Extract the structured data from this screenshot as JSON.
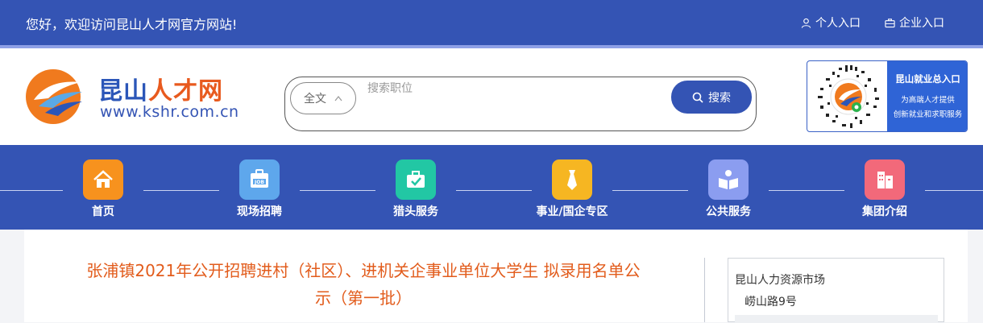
{
  "topbar": {
    "welcome": "您好，欢迎访问昆山人才网官方网站!",
    "personal_entry": "个人入口",
    "company_entry": "企业入口"
  },
  "logo": {
    "cn_part1": "昆山",
    "cn_part2": "人才网",
    "en": "www.kshr.com.cn"
  },
  "search": {
    "scope": "全文",
    "placeholder": "搜索职位",
    "button": "搜索"
  },
  "promo": {
    "title": "昆山就业总入口",
    "line1": "为高端人才提供",
    "line2": "创新就业和求职服务"
  },
  "nav": {
    "items": [
      {
        "label": "首页",
        "icon": "home-icon",
        "color": "#f7921e"
      },
      {
        "label": "现场招聘",
        "icon": "job-icon",
        "color": "#5ea7ec"
      },
      {
        "label": "猎头服务",
        "icon": "briefcase-icon",
        "color": "#22c7a4"
      },
      {
        "label": "事业/国企专区",
        "icon": "tie-icon",
        "color": "#f6b622"
      },
      {
        "label": "公共服务",
        "icon": "book-icon",
        "color": "#8b9df0"
      },
      {
        "label": "集团介绍",
        "icon": "building-icon",
        "color": "#f2697a"
      }
    ]
  },
  "article": {
    "title_line1": "张浦镇2021年公开招聘进村（社区）、进机关企事业单位大学生 拟录用名单公",
    "title_line2": "示（第一批）"
  },
  "market": {
    "name": "昆山人力资源市场",
    "address": "崂山路9号"
  }
}
